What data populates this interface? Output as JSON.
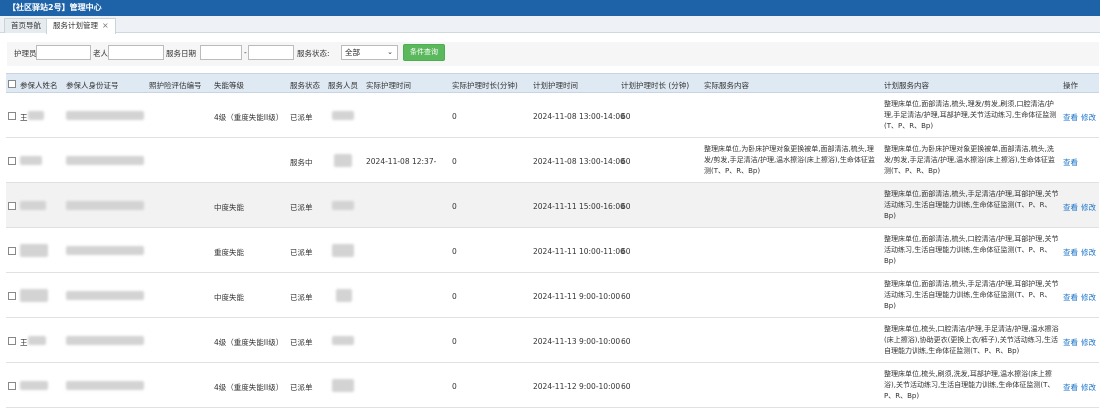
{
  "app": {
    "title": "【社区驿站2号】管理中心"
  },
  "tabs": [
    {
      "label": "首页导航",
      "active": false
    },
    {
      "label": "服务计划管理",
      "active": true,
      "close": "×"
    }
  ],
  "filters": {
    "nurse_label": "护理员",
    "elder_label": "老人",
    "date_label": "服务日期",
    "range_sep": "-",
    "status_label": "服务状态:",
    "status_value": "全部",
    "query_button": "条件查询"
  },
  "table": {
    "columns": [
      "参保人姓名",
      "参保人身份证号",
      "照护险评估编号",
      "失能等级",
      "服务状态",
      "服务人员",
      "实际护理时间",
      "实际护理时长(分钟)",
      "计划护理时间",
      "计划护理时长 (分钟)",
      "实际服务内容",
      "计划服务内容",
      "操作"
    ],
    "rows": [
      {
        "name": "王",
        "level": "4级（重度失能II级）",
        "status": "已派单",
        "actual_time": "",
        "actual_duration": "0",
        "plan_time": "2024-11-08 13:00-14:00",
        "plan_duration": "60",
        "actual_content": "",
        "plan_content": "整理床单位,面部清洁,梳头,理发/剪发,刷须,口腔清洁/护理,手足清洁/护理,耳部护理,关节活动练习,生命体征监测(T、P、R、Bp)",
        "actions": [
          "查看",
          "修改"
        ]
      },
      {
        "name": "",
        "level": "",
        "status": "服务中",
        "actual_time": "2024-11-08 12:37-",
        "actual_duration": "0",
        "plan_time": "2024-11-08 13:00-14:00",
        "plan_duration": "60",
        "actual_content": "整理床单位,为卧床护理对象更换被单,面部清洁,梳头,理发/剪发,手足清洁/护理,温水擦浴(床上擦浴),生命体征监测(T、P、R、Bp)",
        "plan_content": "整理床单位,为卧床护理对象更换被单,面部清洁,梳头,洗发/剪发,手足清洁/护理,温水擦浴(床上擦浴),生命体征监测(T、P、R、Bp)",
        "actions": [
          "查看"
        ]
      },
      {
        "name": "",
        "level": "中度失能",
        "status": "已派单",
        "actual_time": "",
        "actual_duration": "0",
        "plan_time": "2024-11-11 15:00-16:00",
        "plan_duration": "60",
        "actual_content": "",
        "plan_content": "整理床单位,面部清洁,梳头,手足清洁/护理,耳部护理,关节活动练习,生活自理能力训练,生命体征监测(T、P、R、Bp)",
        "actions": [
          "查看",
          "修改"
        ]
      },
      {
        "name": "",
        "level": "重度失能",
        "status": "已派单",
        "actual_time": "",
        "actual_duration": "0",
        "plan_time": "2024-11-11 10:00-11:00",
        "plan_duration": "60",
        "actual_content": "",
        "plan_content": "整理床单位,面部清洁,梳头,口腔清洁/护理,耳部护理,关节活动练习,生活自理能力训练,生命体征监测(T、P、R、Bp)",
        "actions": [
          "查看",
          "修改"
        ]
      },
      {
        "name": "",
        "level": "中度失能",
        "status": "已派单",
        "actual_time": "",
        "actual_duration": "0",
        "plan_time": "2024-11-11 9:00-10:00",
        "plan_duration": "60",
        "actual_content": "",
        "plan_content": "整理床单位,面部清洁,梳头,手足清洁/护理,耳部护理,关节活动练习,生活自理能力训练,生命体征监测(T、P、R、Bp)",
        "actions": [
          "查看",
          "修改"
        ]
      },
      {
        "name": "王",
        "level": "4级（重度失能II级）",
        "status": "已派单",
        "actual_time": "",
        "actual_duration": "0",
        "plan_time": "2024-11-13 9:00-10:00",
        "plan_duration": "60",
        "actual_content": "",
        "plan_content": "整理床单位,梳头,口腔清洁/护理,手足清洁/护理,温水擦浴(床上擦浴),协助更衣(更换上衣/裤子),关节活动练习,生活自理能力训练,生命体征监测(T、P、R、Bp)",
        "actions": [
          "查看",
          "修改"
        ]
      },
      {
        "name": "",
        "level": "4级（重度失能II级）",
        "status": "已派单",
        "actual_time": "",
        "actual_duration": "0",
        "plan_time": "2024-11-12 9:00-10:00",
        "plan_duration": "60",
        "actual_content": "",
        "plan_content": "整理床单位,梳头,刷须,洗发,耳部护理,温水擦浴(床上擦浴),关节活动练习,生活自理能力训练,生命体征监测(T、P、R、Bp)",
        "actions": [
          "查看",
          "修改"
        ]
      }
    ]
  }
}
